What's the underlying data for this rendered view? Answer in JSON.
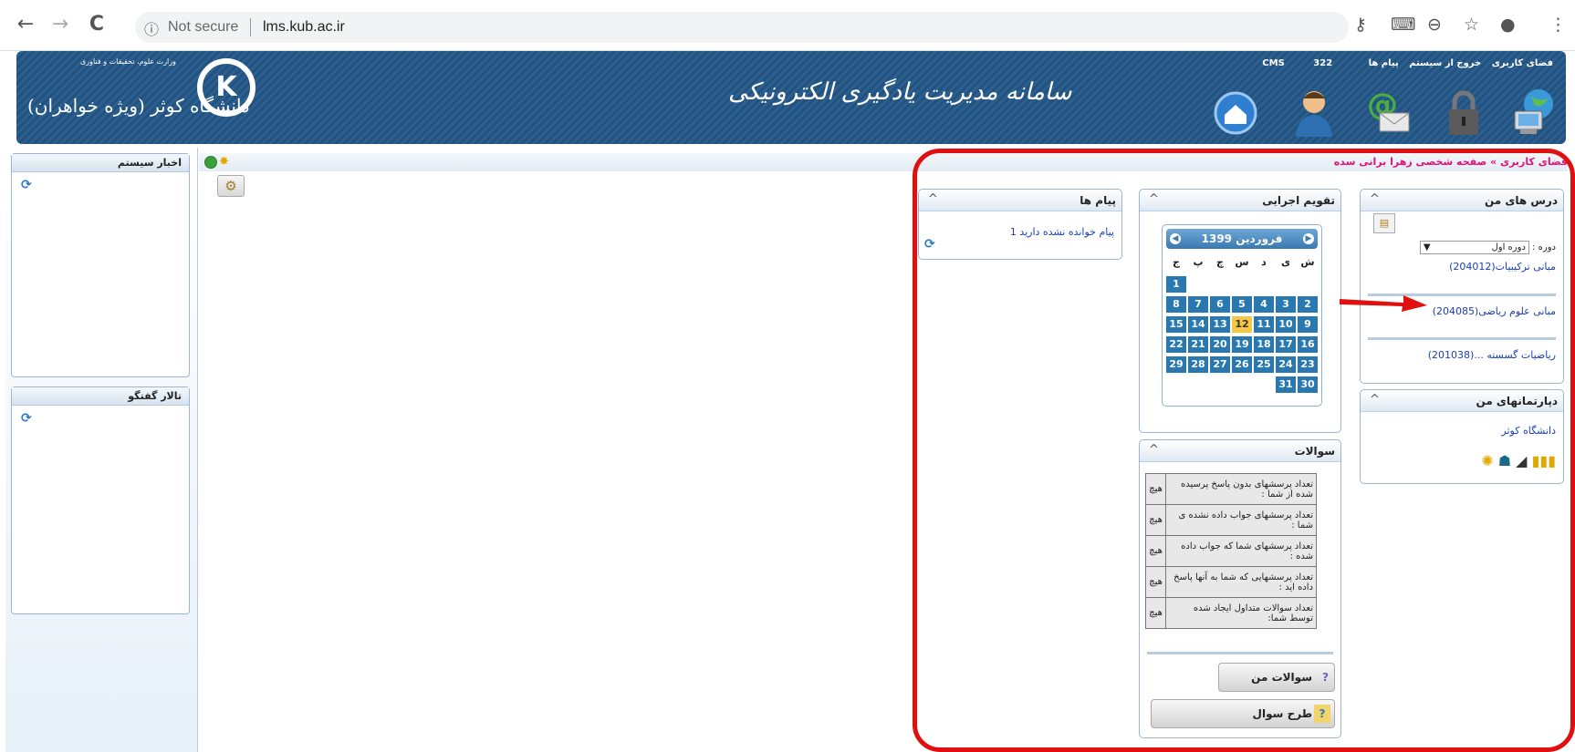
{
  "browser": {
    "back": "←",
    "forward": "→",
    "reload": "C",
    "info_icon": "ⓘ",
    "security": "Not secure",
    "url": "lms.kub.ac.ir",
    "right_icons": [
      "key-icon",
      "translate-icon",
      "zoom-icon",
      "star-icon",
      "profile-icon",
      "menu-icon"
    ]
  },
  "header": {
    "ministry": "وزارت علوم، تحقیقات و فناوری",
    "university": "دانشگاه کوثر (ویژه خواهران)",
    "logo_glyph": "K",
    "system_title": "سامانه مدیریت یادگیری الکترونیکی",
    "links": {
      "user_space": "فضای کاربری",
      "logout": "خروج از سیستم",
      "messages": "پیام ها",
      "count": "322",
      "cms": "CMS"
    }
  },
  "left": {
    "news_title": "اخبار سیستم",
    "forum_title": "تالار گفتگو",
    "refresh_glyph": "⟳"
  },
  "breadcrumb": {
    "root": "فضای کاربری",
    "sep": "»",
    "page": "صفحه شخصی زهرا برانی سده"
  },
  "courses": {
    "title": "درس های من",
    "term_label": "دوره :",
    "term_value": "دوره اول",
    "items": [
      "مبانی ترکیبیات(204012)",
      "مبانی علوم ریاضی(204085)",
      "ریاضیات گسسته ...(201038)"
    ]
  },
  "departments": {
    "title": "دپارتمانهای من",
    "items": [
      "دانشگاه کوثر"
    ]
  },
  "calendar": {
    "title": "تقویم اجرایی",
    "month": "فروردین 1399",
    "weekdays": [
      "ش",
      "ی",
      "د",
      "س",
      "چ",
      "پ",
      "ج"
    ],
    "weeks": [
      [
        "",
        "",
        "",
        "",
        "",
        "",
        "1"
      ],
      [
        "2",
        "3",
        "4",
        "5",
        "6",
        "7",
        "8"
      ],
      [
        "9",
        "10",
        "11",
        "12",
        "13",
        "14",
        "15"
      ],
      [
        "16",
        "17",
        "18",
        "19",
        "20",
        "21",
        "22"
      ],
      [
        "23",
        "24",
        "25",
        "26",
        "27",
        "28",
        "29"
      ],
      [
        "30",
        "31",
        "",
        "",
        "",
        "",
        ""
      ]
    ],
    "today": "12"
  },
  "questions": {
    "title": "سوالات",
    "rows": [
      {
        "label": "تعداد پرسشهای بدون پاسخ پرسیده شده از شما :",
        "value": "هیچ"
      },
      {
        "label": "تعداد پرسشهای جواب داده نشده ی شما :",
        "value": "هیچ"
      },
      {
        "label": "تعداد پرسشهای شما که جواب داده شده :",
        "value": "هیچ"
      },
      {
        "label": "تعداد پرسشهایی که شما به آنها پاسخ داده اید :",
        "value": "هیچ"
      },
      {
        "label": "تعداد سوالات متداول ایجاد شده توسط شما:",
        "value": "هیچ"
      }
    ],
    "my_questions": "سوالات من",
    "design_question": "طرح سوال"
  },
  "messages": {
    "title": "پیام ها",
    "unread": "1 پیام خوانده نشده دارید"
  },
  "colors": {
    "banner": "#2b5f8f",
    "highlight": "#e01010",
    "calendar_day": "#2a78b0",
    "today": "#f5c842",
    "breadcrumb": "#e0127a"
  }
}
